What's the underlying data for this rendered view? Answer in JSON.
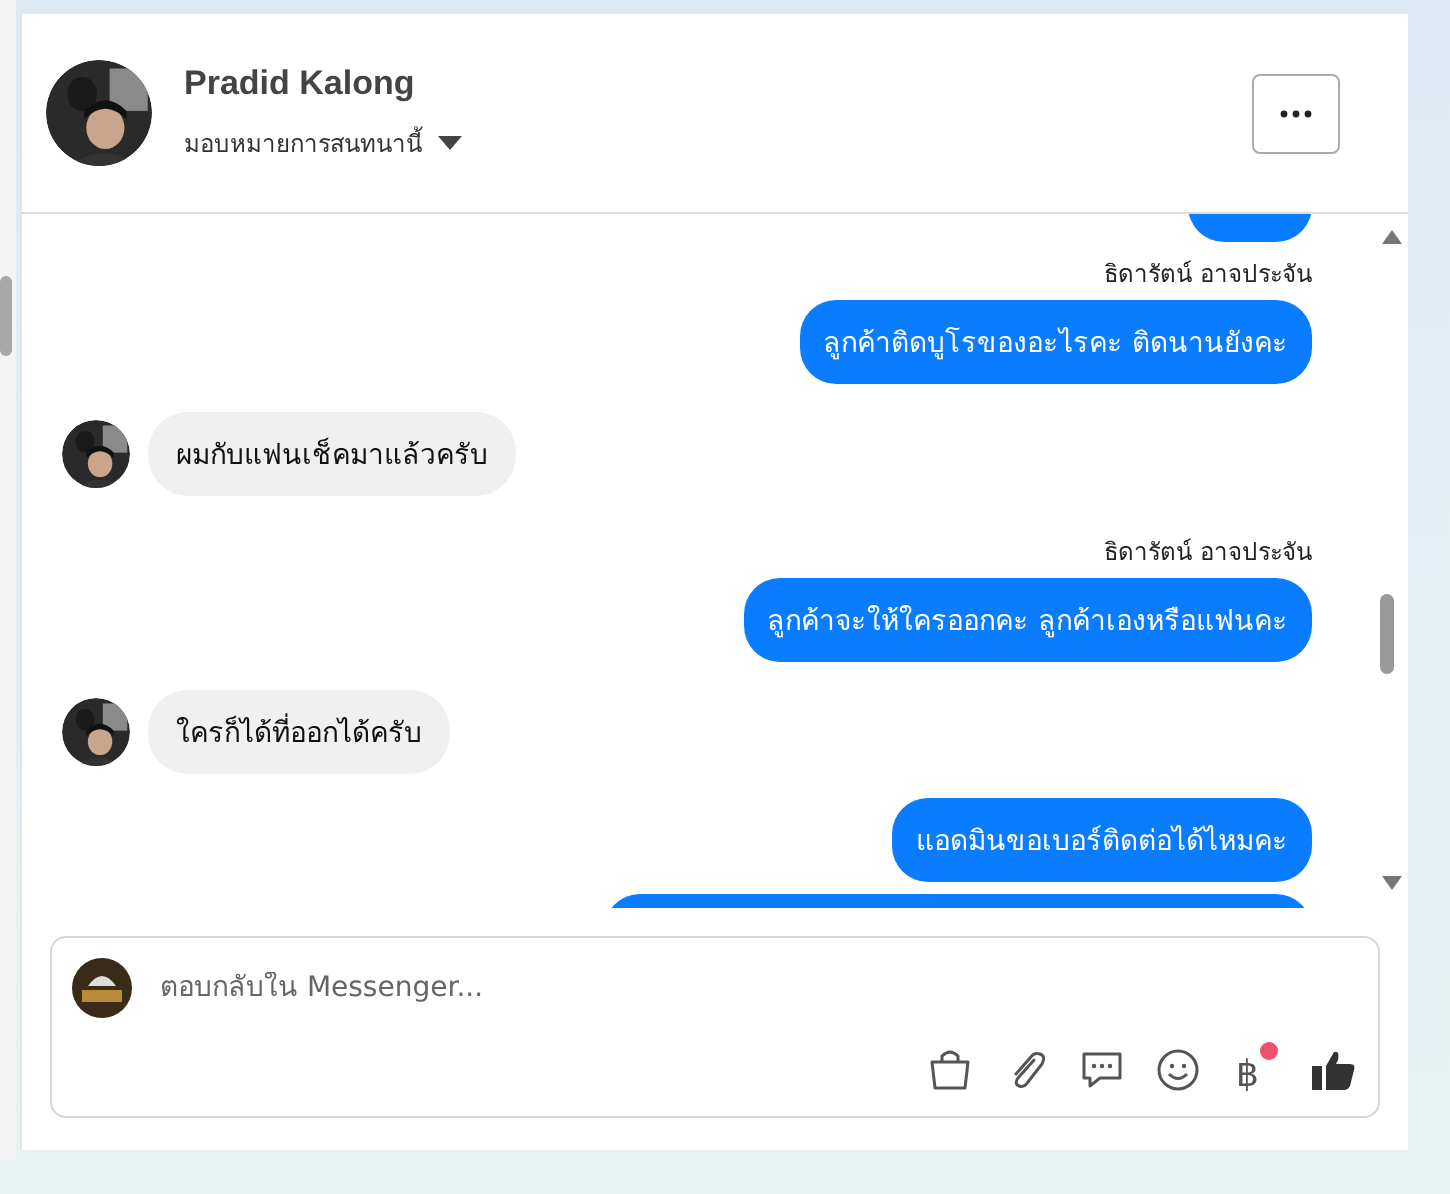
{
  "conversation": {
    "name": "Pradid Kalong",
    "assign_label": "มอบหมายการสนทนานี้"
  },
  "messages": [
    {
      "kind": "outgoing-cut-top"
    },
    {
      "kind": "sender",
      "text": "ธิดารัตน์ อาจประจัน"
    },
    {
      "kind": "outgoing",
      "text": "ลูกค้าติดบูโรของอะไรคะ ติดนานยังคะ"
    },
    {
      "kind": "incoming",
      "text": "ผมกับแฟนเช็คมาแล้วครับ"
    },
    {
      "kind": "sender",
      "text": "ธิดารัตน์ อาจประจัน"
    },
    {
      "kind": "outgoing",
      "text": "ลูกค้าจะให้ใครออกคะ ลูกค้าเองหรือแฟนคะ"
    },
    {
      "kind": "incoming",
      "text": "ใครก็ได้ที่ออกได้ครับ"
    },
    {
      "kind": "outgoing",
      "text": "แอดมินขอเบอร์ติดต่อได้ไหมคะ"
    },
    {
      "kind": "outgoing-cut-bottom"
    }
  ],
  "composer": {
    "placeholder": "ตอบกลับใน Messenger...",
    "payment_symbol": "฿",
    "payment_badge": true
  }
}
